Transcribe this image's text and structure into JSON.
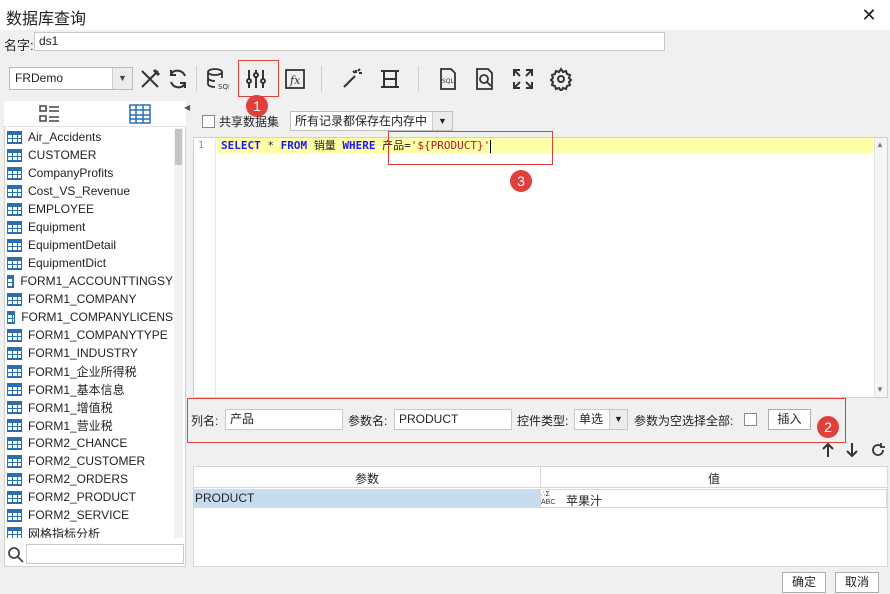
{
  "window": {
    "title": "数据库查询"
  },
  "name": {
    "label": "名字:",
    "value": "ds1"
  },
  "toolbar": {
    "connection": "FRDemo",
    "icons": [
      "tools-icon",
      "refresh-icon",
      "database-sql-icon",
      "param-sliders-icon",
      "formula-icon",
      "wizard-icon",
      "column-split-icon",
      "sql-icon",
      "query-preview-icon",
      "fullscreen-icon",
      "settings-icon"
    ]
  },
  "tables": [
    "Air_Accidents",
    "CUSTOMER",
    "CompanyProfits",
    "Cost_VS_Revenue",
    "EMPLOYEE",
    "Equipment",
    "EquipmentDetail",
    "EquipmentDict",
    "FORM1_ACCOUNTTINGSY",
    "FORM1_COMPANY",
    "FORM1_COMPANYLICENS",
    "FORM1_COMPANYTYPE",
    "FORM1_INDUSTRY",
    "FORM1_企业所得税",
    "FORM1_基本信息",
    "FORM1_增值税",
    "FORM1_营业税",
    "FORM2_CHANCE",
    "FORM2_CUSTOMER",
    "FORM2_ORDERS",
    "FORM2_PRODUCT",
    "FORM2_SERVICE",
    "网格指标分析"
  ],
  "share": {
    "label": "共享数据集",
    "memory": "所有记录都保存在内存中"
  },
  "editor": {
    "line_number": "1",
    "sql": {
      "select": "SELECT",
      "star": " * ",
      "from": "FROM",
      "table": " 销量 ",
      "where": "WHERE",
      "cond": " 产品=",
      "param": "'${PRODUCT}'"
    }
  },
  "param_form": {
    "column_label": "列名:",
    "column_value": "产品",
    "param_label": "参数名:",
    "param_value": "PRODUCT",
    "control_label": "控件类型:",
    "control_value": "单选",
    "empty_label": "参数为空选择全部:",
    "insert_label": "插入"
  },
  "param_table": {
    "headers": [
      "参数",
      "值"
    ],
    "rows": [
      {
        "param": "PRODUCT",
        "value": "苹果汁"
      }
    ]
  },
  "badges": [
    "1",
    "2",
    "3"
  ],
  "footer": {
    "ok": "确定",
    "cancel": "取消"
  },
  "colors": {
    "accent": "#e0403c",
    "keyword": "#1a1aff",
    "string": "#b11a1a",
    "highlight": "#ffffa8",
    "selection": "#c8dcf0"
  }
}
